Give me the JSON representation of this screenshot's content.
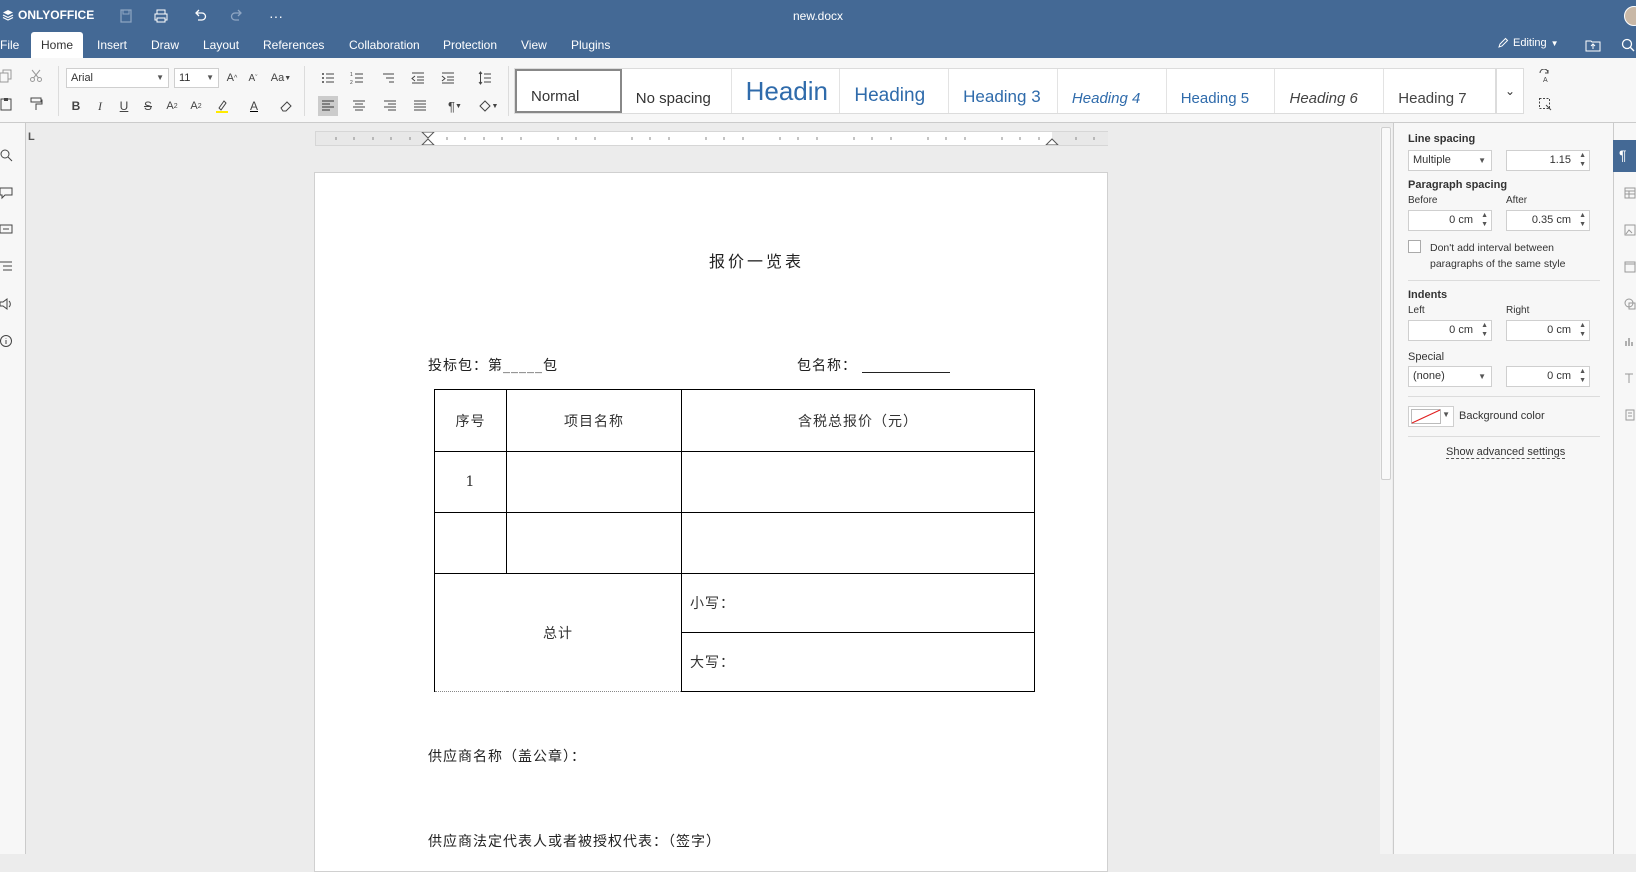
{
  "app": {
    "name": "ONLYOFFICE",
    "doc_title": "new.docx"
  },
  "tabs": [
    "File",
    "Home",
    "Insert",
    "Draw",
    "Layout",
    "References",
    "Collaboration",
    "Protection",
    "View",
    "Plugins"
  ],
  "active_tab": "Home",
  "mode": {
    "label": "Editing"
  },
  "font": {
    "name": "Arial",
    "size": "11"
  },
  "styles": [
    "Normal",
    "No spacing",
    "Headin",
    "Heading",
    "Heading 3",
    "Heading 4",
    "Heading 5",
    "Heading 6",
    "Heading 7"
  ],
  "ribbon": {
    "bold": "B",
    "italic": "I",
    "underline": "U",
    "strike": "S"
  },
  "ruler_corner": "L",
  "document": {
    "title": "报价一览表",
    "package_label": "投标包：第_____包",
    "package_name_label": "包名称：",
    "table": {
      "headers": [
        "序号",
        "项目名称",
        "含税总报价（元）"
      ],
      "row1_index": "1",
      "total_label": "总计",
      "lower_label": "小写：",
      "upper_label": "大写："
    },
    "supplier": "供应商名称（盖公章）：",
    "representative": "供应商法定代表人或者被授权代表：（签字）"
  },
  "panel": {
    "line_spacing": {
      "label": "Line spacing",
      "type": "Multiple",
      "value": "1.15"
    },
    "paragraph_spacing": {
      "label": "Paragraph spacing",
      "before_label": "Before",
      "after_label": "After",
      "before": "0 cm",
      "after": "0.35 cm"
    },
    "dont_add_interval": "Don't add interval between paragraphs of the same style",
    "indents": {
      "label": "Indents",
      "left_label": "Left",
      "right_label": "Right",
      "left": "0 cm",
      "right": "0 cm"
    },
    "special": {
      "label": "Special",
      "type": "(none)",
      "value": "0 cm"
    },
    "background_color": "Background color",
    "advanced": "Show advanced settings"
  },
  "colors": {
    "header_bg": "#446995",
    "ribbon_bg": "#f7f7f7",
    "canvas_bg": "#ececec"
  }
}
